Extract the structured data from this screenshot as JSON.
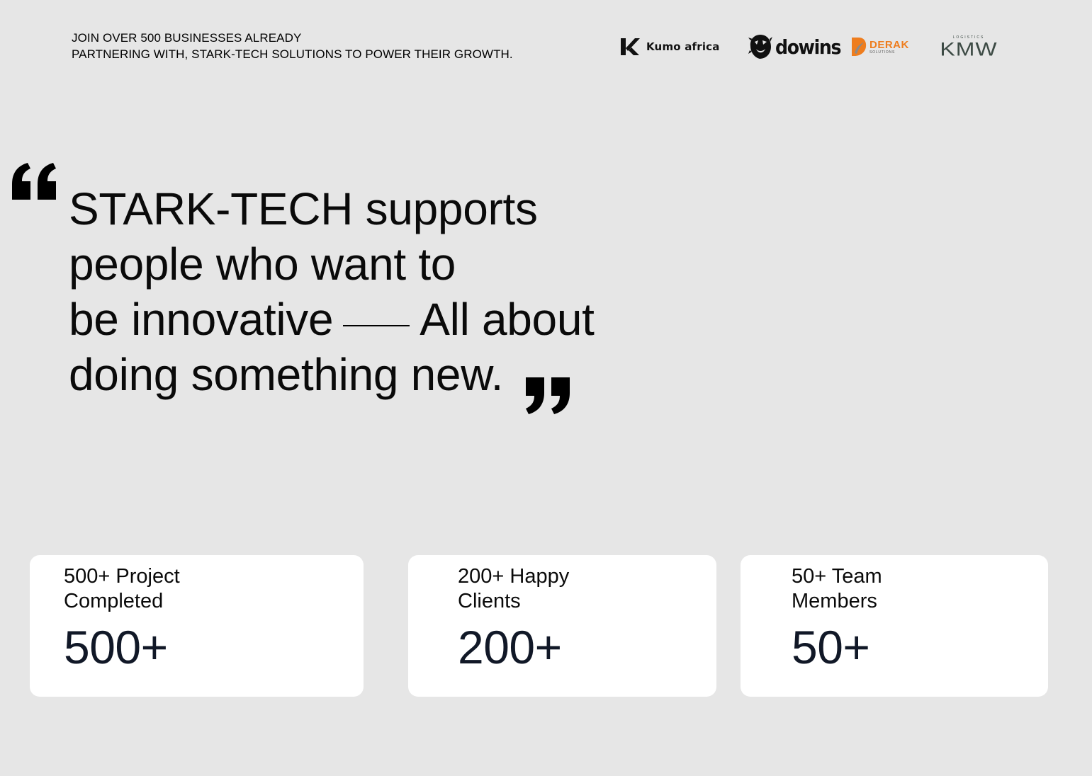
{
  "partners": {
    "line1": "JOIN OVER 500 BUSINESSES ALREADY",
    "line2": "PARTNERING WITH, STARK-TECH SOLUTIONS TO POWER THEIR GROWTH.",
    "logos": [
      {
        "name": "Kumo africa",
        "text": "Kumo africa",
        "icon": "kumo-k-icon"
      },
      {
        "name": "dowins",
        "text": "dowins",
        "icon": "lion-head-icon"
      },
      {
        "name": "DERAK",
        "text": "DERAK",
        "subtext": "SOLUTIONS",
        "icon": "derak-leaf-icon",
        "color": "#ee7d1e"
      },
      {
        "name": "KMW",
        "text": "KMW",
        "subtext": "LOGISTICS",
        "color": "#3c4a44"
      }
    ]
  },
  "quote": {
    "line1": "STARK-TECH supports",
    "line2": "people who want to",
    "line3a": "be innovative",
    "line3b": "All about",
    "line4": "doing something new.",
    "open_icon": "open-quote-icon",
    "close_icon": "close-quote-icon"
  },
  "stats": [
    {
      "label_line1": "500+ Project",
      "label_line2": "Completed",
      "value": "500+"
    },
    {
      "label_line1": "200+ Happy",
      "label_line2": "Clients",
      "value": "200+"
    },
    {
      "label_line1": "50+ Team",
      "label_line2": "Members",
      "value": "50+"
    }
  ],
  "colors": {
    "background": "#e6e6e6",
    "card": "#ffffff",
    "stat_value": "#111827",
    "derak_orange": "#ee7d1e",
    "kmw_green": "#3c4a44"
  }
}
